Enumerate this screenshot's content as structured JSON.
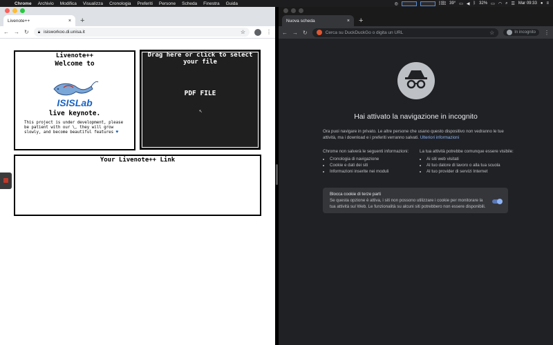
{
  "menubar": {
    "app": "Chrome",
    "items": [
      "Archivio",
      "Modifica",
      "Visualizza",
      "Cronologia",
      "Preferiti",
      "Persone",
      "Scheda",
      "Finestra",
      "Guida"
    ],
    "status": {
      "net_up": "0 KB/s",
      "net_down": "0 KB/s",
      "temperature": "39°",
      "battery": "32%",
      "clock": "Mar 09:33"
    }
  },
  "left_browser": {
    "tab_title": "Livenote++",
    "url": "isisworkoo.di.unisa.it",
    "page": {
      "welcome_box_title": "Livenote++",
      "welcome_heading": "Welcome to",
      "brand": "ISISLab",
      "subheading": "live keynote.",
      "description": "This project is under development, please be patient with our \\, they will grow slowly, and become beautiful features ",
      "dropzone_title": "Drag here or click to select your file",
      "dropzone_label": "PDF FILE",
      "link_box_title": "Your Livenote++ Link"
    }
  },
  "right_browser": {
    "tab_title": "Nuova scheda",
    "omnibox_placeholder": "Cerca su DuckDuckGo o digita un URL",
    "incognito_badge": "In incognito",
    "page": {
      "title": "Hai attivato la navigazione in incognito",
      "intro": "Ora puoi navigare in privato. Le altre persone che usano questo dispositivo non vedranno le tue attività, ma i download e i preferiti verranno salvati.",
      "intro_link": "Ulteriori informazioni",
      "not_saved_heading": "Chrome non salverà le seguenti informazioni:",
      "not_saved_items": [
        "Cronologia di navigazione",
        "Cookie e dati dei siti",
        "Informazioni inserite nei moduli"
      ],
      "visible_heading": "La tua attività potrebbe comunque essere visibile:",
      "visible_items": [
        "Ai siti web visitati",
        "Al tuo datore di lavoro o alla tua scuola",
        "Al tuo provider di servizi Internet"
      ],
      "cookie_title": "Blocca cookie di terze parti",
      "cookie_desc": "Se questa opzione è attiva, i siti non possono utilizzare i cookie per monitorare la tua attività sul Web. Le funzionalità su alcuni siti potrebbero non essere disponibili.",
      "cookie_toggle_on": true
    }
  },
  "colors": {
    "incognito_bg": "#202124",
    "link_blue": "#8ab4f8",
    "brand_blue": "#1a63c0"
  }
}
